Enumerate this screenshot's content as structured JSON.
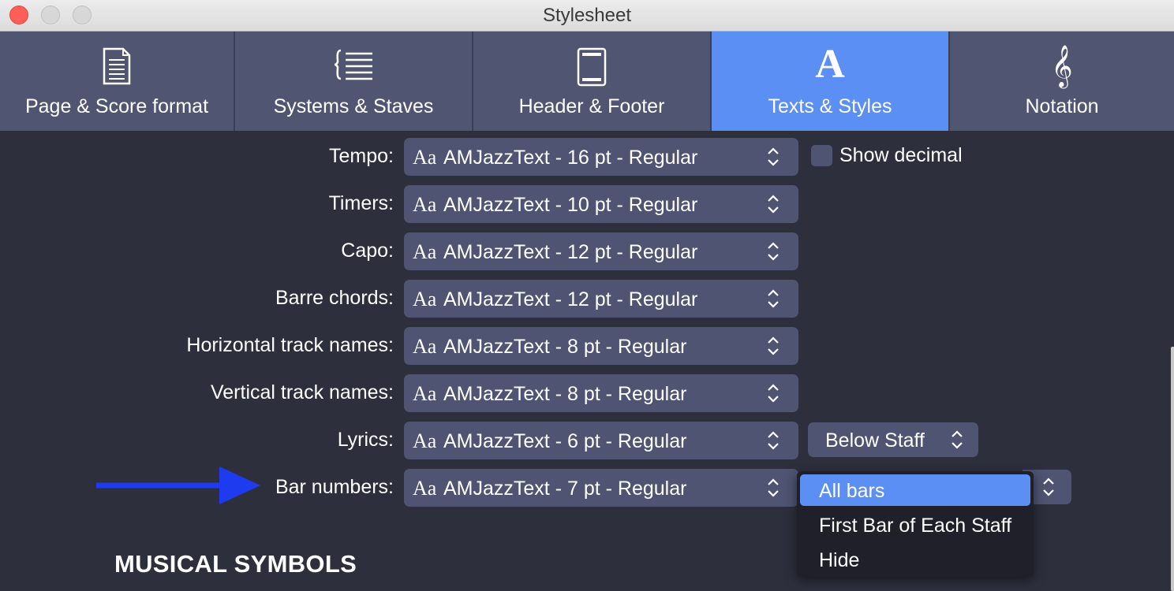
{
  "window": {
    "title": "Stylesheet"
  },
  "tabs": [
    {
      "label": "Page & Score format",
      "icon": "page-icon",
      "active": false
    },
    {
      "label": "Systems & Staves",
      "icon": "staves-icon",
      "active": false
    },
    {
      "label": "Header & Footer",
      "icon": "header-footer-icon",
      "active": false
    },
    {
      "label": "Texts & Styles",
      "icon": "font-a-icon",
      "active": true
    },
    {
      "label": "Notation",
      "icon": "treble-clef-icon",
      "active": false
    }
  ],
  "rows": [
    {
      "label": "Tempo:",
      "value": "AMJazzText - 16 pt - Regular"
    },
    {
      "label": "Timers:",
      "value": "AMJazzText - 10 pt - Regular"
    },
    {
      "label": "Capo:",
      "value": "AMJazzText - 12 pt - Regular"
    },
    {
      "label": "Barre chords:",
      "value": "AMJazzText - 12 pt - Regular"
    },
    {
      "label": "Horizontal track names:",
      "value": "AMJazzText - 8 pt - Regular"
    },
    {
      "label": "Vertical track names:",
      "value": "AMJazzText - 8 pt - Regular"
    },
    {
      "label": "Lyrics:",
      "value": "AMJazzText - 6 pt - Regular"
    },
    {
      "label": "Bar numbers:",
      "value": "AMJazzText - 7 pt - Regular"
    }
  ],
  "font_prefix": "Aa",
  "show_decimal": {
    "label": "Show decimal",
    "checked": false
  },
  "lyrics_position": {
    "value": "Below Staff"
  },
  "bar_numbers_menu": {
    "options": [
      "All bars",
      "First Bar of Each Staff",
      "Hide"
    ],
    "selected": "All bars"
  },
  "section_heading": "MUSICAL SYMBOLS",
  "colors": {
    "accent": "#5b8ff4",
    "arrow": "#1f3bf0",
    "background": "#2d2f3d"
  }
}
